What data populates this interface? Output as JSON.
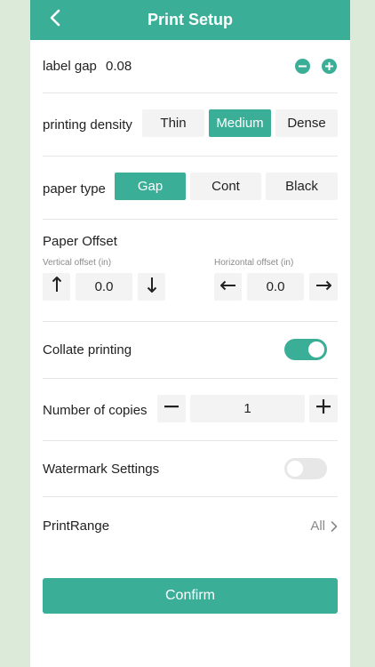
{
  "header": {
    "title": "Print Setup",
    "back_icon": "chevron-left-icon"
  },
  "label_gap": {
    "label": "label gap",
    "value": "0.08",
    "decrease_icon": "minus-circle-icon",
    "increase_icon": "plus-circle-icon"
  },
  "density": {
    "label": "printing density",
    "options": [
      "Thin",
      "Medium",
      "Dense"
    ],
    "selected": "Medium"
  },
  "paper_type": {
    "label": "paper type",
    "options": [
      "Gap",
      "Cont",
      "Black"
    ],
    "selected": "Gap"
  },
  "paper_offset": {
    "title": "Paper Offset",
    "vertical": {
      "label": "Vertical offset (in)",
      "value": "0.0",
      "up_icon": "arrow-up-icon",
      "down_icon": "arrow-down-icon"
    },
    "horizontal": {
      "label": "Horizontal offset (in)",
      "value": "0.0",
      "left_icon": "arrow-left-icon",
      "right_icon": "arrow-right-icon"
    }
  },
  "collate": {
    "label": "Collate printing",
    "enabled": true
  },
  "copies": {
    "label": "Number of copies",
    "value": "1",
    "decrease_icon": "minus-icon",
    "increase_icon": "plus-icon"
  },
  "watermark": {
    "label": "Watermark Settings",
    "enabled": false
  },
  "print_range": {
    "label": "PrintRange",
    "value": "All",
    "chevron_icon": "chevron-right-icon"
  },
  "confirm": {
    "label": "Confirm"
  },
  "colors": {
    "accent": "#3aae97",
    "background": "#dcebd9",
    "surface": "#ffffff",
    "control_bg": "#f3f3f3"
  }
}
